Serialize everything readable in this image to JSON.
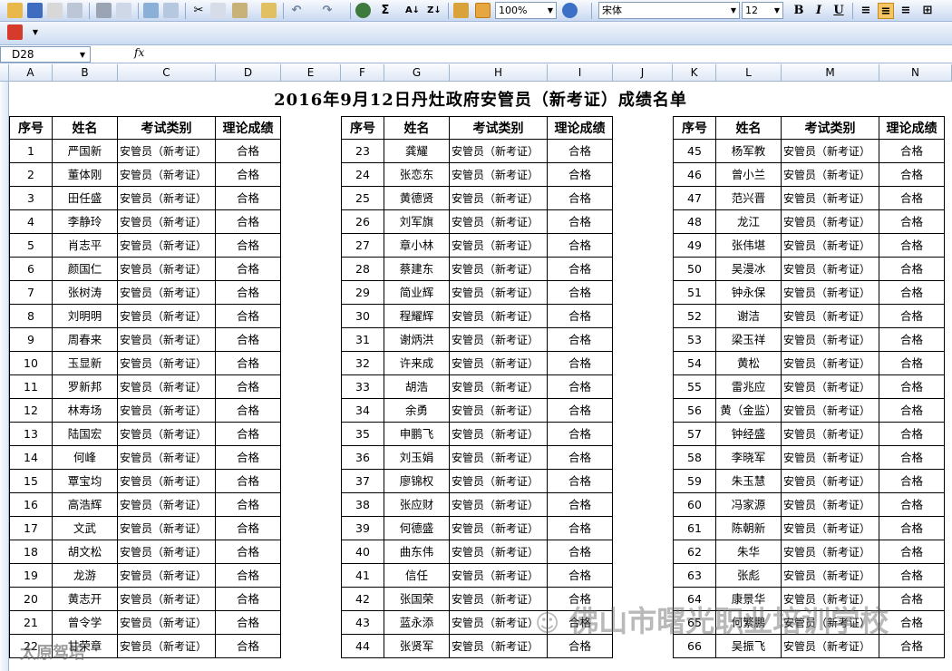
{
  "toolbar": {
    "zoom": "100%",
    "font_name": "宋体",
    "font_size": "12",
    "bold": "B",
    "italic": "I",
    "underline": "U",
    "sum": "Σ"
  },
  "formula": {
    "namebox": "D28",
    "fx": "fx",
    "content": ""
  },
  "columns": [
    "A",
    "B",
    "C",
    "D",
    "E",
    "F",
    "G",
    "H",
    "I",
    "J",
    "K",
    "L",
    "M",
    "N"
  ],
  "sheet": {
    "title": "2016年9月12日丹灶政府安管员（新考证）成绩名单",
    "headers": [
      "序号",
      "姓名",
      "考试类别",
      "理论成绩"
    ],
    "category": "安管员（新考证）",
    "result": "合格",
    "block1": [
      {
        "n": "1",
        "name": "严国新"
      },
      {
        "n": "2",
        "name": "董体刚"
      },
      {
        "n": "3",
        "name": "田任盛"
      },
      {
        "n": "4",
        "name": "李静玲"
      },
      {
        "n": "5",
        "name": "肖志平"
      },
      {
        "n": "6",
        "name": "颜国仁"
      },
      {
        "n": "7",
        "name": "张树涛"
      },
      {
        "n": "8",
        "name": "刘明明"
      },
      {
        "n": "9",
        "name": "周春来"
      },
      {
        "n": "10",
        "name": "玉显新"
      },
      {
        "n": "11",
        "name": "罗新邦"
      },
      {
        "n": "12",
        "name": "林寿场"
      },
      {
        "n": "13",
        "name": "陆国宏"
      },
      {
        "n": "14",
        "name": "何峰"
      },
      {
        "n": "15",
        "name": "覃宝均"
      },
      {
        "n": "16",
        "name": "高浩辉"
      },
      {
        "n": "17",
        "name": "文武"
      },
      {
        "n": "18",
        "name": "胡文松"
      },
      {
        "n": "19",
        "name": "龙游"
      },
      {
        "n": "20",
        "name": "黄志开"
      },
      {
        "n": "21",
        "name": "曾令学"
      },
      {
        "n": "22",
        "name": "甘荣章"
      }
    ],
    "block2": [
      {
        "n": "23",
        "name": "龚耀"
      },
      {
        "n": "24",
        "name": "张恋东"
      },
      {
        "n": "25",
        "name": "黄德贤"
      },
      {
        "n": "26",
        "name": "刘军旗"
      },
      {
        "n": "27",
        "name": "章小林"
      },
      {
        "n": "28",
        "name": "蔡建东"
      },
      {
        "n": "29",
        "name": "简业辉"
      },
      {
        "n": "30",
        "name": "程耀辉"
      },
      {
        "n": "31",
        "name": "谢炳洪"
      },
      {
        "n": "32",
        "name": "许来成"
      },
      {
        "n": "33",
        "name": "胡浩"
      },
      {
        "n": "34",
        "name": "余勇"
      },
      {
        "n": "35",
        "name": "申鹏飞"
      },
      {
        "n": "36",
        "name": "刘玉娟"
      },
      {
        "n": "37",
        "name": "廖锦权"
      },
      {
        "n": "38",
        "name": "张应财"
      },
      {
        "n": "39",
        "name": "何德盛"
      },
      {
        "n": "40",
        "name": "曲东伟"
      },
      {
        "n": "41",
        "name": "信任"
      },
      {
        "n": "42",
        "name": "张国荣"
      },
      {
        "n": "43",
        "name": "蓝永添"
      },
      {
        "n": "44",
        "name": "张贤军"
      }
    ],
    "block3": [
      {
        "n": "45",
        "name": "杨军教"
      },
      {
        "n": "46",
        "name": "曾小兰"
      },
      {
        "n": "47",
        "name": "范兴晋"
      },
      {
        "n": "48",
        "name": "龙江"
      },
      {
        "n": "49",
        "name": "张伟堪"
      },
      {
        "n": "50",
        "name": "吴漫冰"
      },
      {
        "n": "51",
        "name": "钟永保"
      },
      {
        "n": "52",
        "name": "谢洁"
      },
      {
        "n": "53",
        "name": "梁玉祥"
      },
      {
        "n": "54",
        "name": "黄松"
      },
      {
        "n": "55",
        "name": "雷兆应"
      },
      {
        "n": "56",
        "name": "黄（金监）"
      },
      {
        "n": "57",
        "name": "钟经盛"
      },
      {
        "n": "58",
        "name": "李晓军"
      },
      {
        "n": "59",
        "name": "朱玉慧"
      },
      {
        "n": "60",
        "name": "冯家源"
      },
      {
        "n": "61",
        "name": "陈朝新"
      },
      {
        "n": "62",
        "name": "朱华"
      },
      {
        "n": "63",
        "name": "张彪"
      },
      {
        "n": "64",
        "name": "康景华"
      },
      {
        "n": "65",
        "name": "何繁鹏"
      },
      {
        "n": "66",
        "name": "吴振飞"
      }
    ]
  },
  "watermark": {
    "left": "太原驾培",
    "right": "佛山市曙光职业培训学校"
  }
}
